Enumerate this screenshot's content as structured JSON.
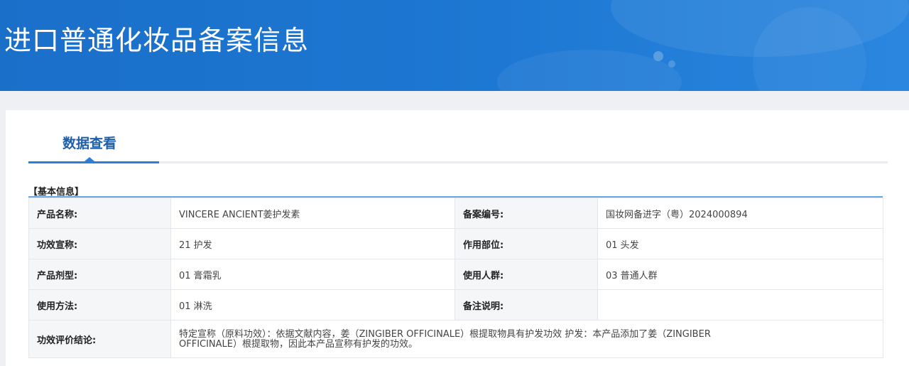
{
  "header": {
    "title": "进口普通化妆品备案信息"
  },
  "tabs": [
    {
      "label": "数据查看",
      "active": true
    }
  ],
  "section": {
    "title": "【基本信息】"
  },
  "fields": {
    "product_name_label": "产品名称:",
    "product_name_value": "VINCERE ANCIENT姜护发素",
    "record_no_label": "备案编号:",
    "record_no_value": "国妆网备进字（粤）2024000894",
    "efficacy_label": "功效宣称:",
    "efficacy_value": "21 护发",
    "site_label": "作用部位:",
    "site_value": "01 头发",
    "dosage_form_label": "产品剂型:",
    "dosage_form_value": "01 膏霜乳",
    "population_label": "使用人群:",
    "population_value": "03 普通人群",
    "usage_label": "使用方法:",
    "usage_value": "01 淋洗",
    "remark_label": "备注说明:",
    "remark_value": "",
    "evaluation_label": "功效评价结论:",
    "evaluation_value": "特定宣称（原料功效）：依据文献内容，姜（ZINGIBER OFFICINALE）根提取物具有护发功效 护发：本产品添加了姜（ZINGIBER OFFICINALE）根提取物，因此本产品宣称有护发的功效。"
  },
  "colors": {
    "banner": "#1d78d3",
    "accent": "#2b7fd6",
    "tab_text": "#1f5fa8",
    "label_bg": "#f5f6f8"
  }
}
